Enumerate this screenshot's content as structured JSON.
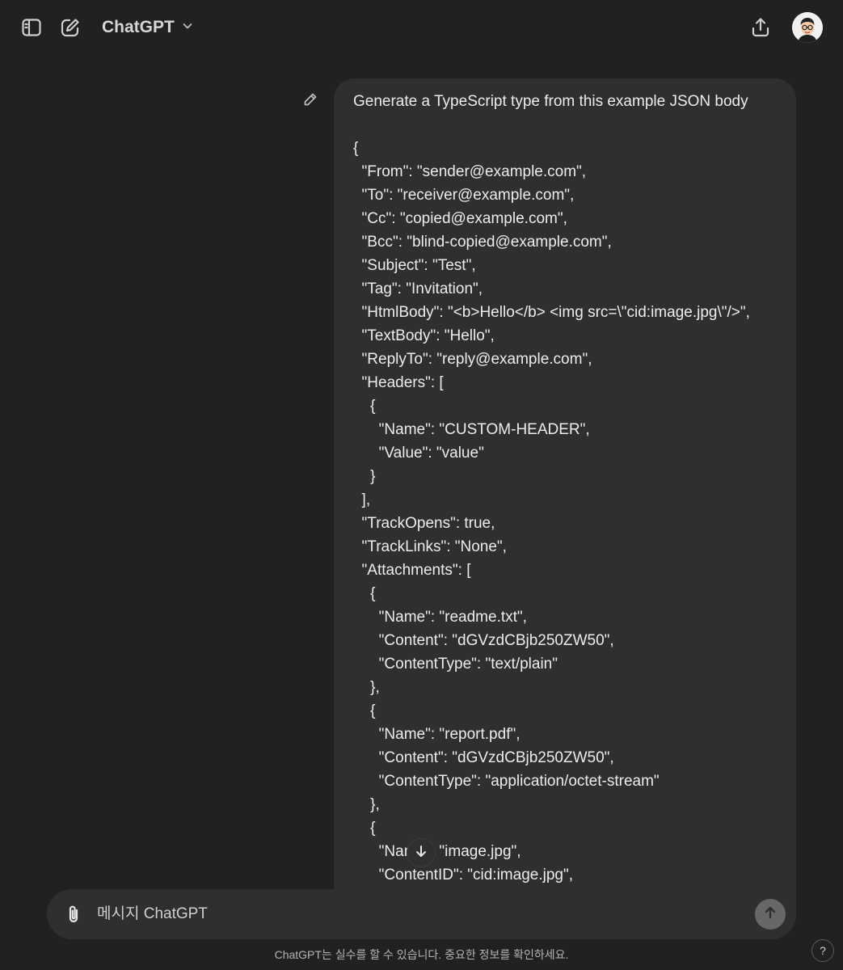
{
  "header": {
    "title": "ChatGPT",
    "icons": {
      "sidebar": "sidebar-toggle-icon",
      "new_chat": "new-chat-icon",
      "model_menu": "chevron-down-icon",
      "share": "share-icon"
    }
  },
  "message": {
    "lines": [
      "Generate a TypeScript type from this example JSON body",
      "",
      "{",
      "  \"From\": \"sender@example.com\",",
      "  \"To\": \"receiver@example.com\",",
      "  \"Cc\": \"copied@example.com\",",
      "  \"Bcc\": \"blind-copied@example.com\",",
      "  \"Subject\": \"Test\",",
      "  \"Tag\": \"Invitation\",",
      "  \"HtmlBody\": \"<b>Hello</b> <img src=\\\"cid:image.jpg\\\"/>\",",
      "  \"TextBody\": \"Hello\",",
      "  \"ReplyTo\": \"reply@example.com\",",
      "  \"Headers\": [",
      "    {",
      "      \"Name\": \"CUSTOM-HEADER\",",
      "      \"Value\": \"value\"",
      "    }",
      "  ],",
      "  \"TrackOpens\": true,",
      "  \"TrackLinks\": \"None\",",
      "  \"Attachments\": [",
      "    {",
      "      \"Name\": \"readme.txt\",",
      "      \"Content\": \"dGVzdCBjb250ZW50\",",
      "      \"ContentType\": \"text/plain\"",
      "    },",
      "    {",
      "      \"Name\": \"report.pdf\",",
      "      \"Content\": \"dGVzdCBjb250ZW50\",",
      "      \"ContentType\": \"application/octet-stream\"",
      "    },",
      "    {",
      "      \"Name\": \"image.jpg\",",
      "      \"ContentID\": \"cid:image.jpg\","
    ]
  },
  "composer": {
    "placeholder": "메시지 ChatGPT"
  },
  "footer": {
    "disclaimer": "ChatGPT는 실수를 할 수 있습니다. 중요한 정보를 확인하세요.",
    "help_label": "?"
  },
  "colors": {
    "background": "#212121",
    "bubble": "#2f2f2f",
    "send_button": "#676767"
  }
}
